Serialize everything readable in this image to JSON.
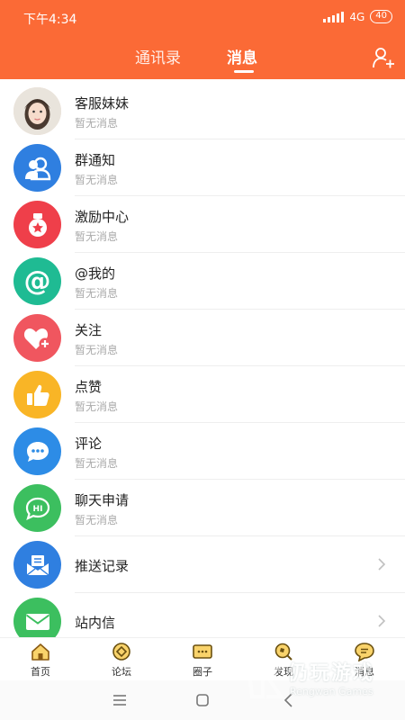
{
  "status_bar": {
    "time": "下午4:34",
    "network": "4G",
    "battery": "40"
  },
  "header": {
    "tabs": [
      {
        "label": "通讯录",
        "active": false
      },
      {
        "label": "消息",
        "active": true
      }
    ],
    "accent_color": "#fb6a36"
  },
  "messages": [
    {
      "title": "客服妹妹",
      "subtitle": "暂无消息",
      "icon": "customer-service-avatar",
      "color": "#f3d9c9"
    },
    {
      "title": "群通知",
      "subtitle": "暂无消息",
      "icon": "group-icon",
      "color": "#2f7fe0"
    },
    {
      "title": "激励中心",
      "subtitle": "暂无消息",
      "icon": "incentive-icon",
      "color": "#ef3f4a"
    },
    {
      "title": "@我的",
      "subtitle": "暂无消息",
      "icon": "at-icon",
      "color": "#1fbb93"
    },
    {
      "title": "关注",
      "subtitle": "暂无消息",
      "icon": "heart-plus-icon",
      "color": "#f0565f"
    },
    {
      "title": "点赞",
      "subtitle": "暂无消息",
      "icon": "thumbs-up-icon",
      "color": "#f9b526"
    },
    {
      "title": "评论",
      "subtitle": "暂无消息",
      "icon": "comment-icon",
      "color": "#2d8ce6"
    },
    {
      "title": "聊天申请",
      "subtitle": "暂无消息",
      "icon": "chat-request-icon",
      "color": "#3cbf5f"
    }
  ],
  "links": [
    {
      "title": "推送记录",
      "icon": "push-record-icon",
      "color": "#2f7fe0"
    },
    {
      "title": "站内信",
      "icon": "mail-icon",
      "color": "#3cbf5f"
    }
  ],
  "bottom_nav": [
    {
      "label": "首页",
      "icon": "home-icon"
    },
    {
      "label": "论坛",
      "icon": "forum-icon"
    },
    {
      "label": "圈子",
      "icon": "circle-icon"
    },
    {
      "label": "发现",
      "icon": "discover-icon"
    },
    {
      "label": "消息",
      "icon": "message-icon"
    }
  ],
  "watermark": {
    "name": "仍玩游戏",
    "subtitle": "Rengwan Games"
  }
}
